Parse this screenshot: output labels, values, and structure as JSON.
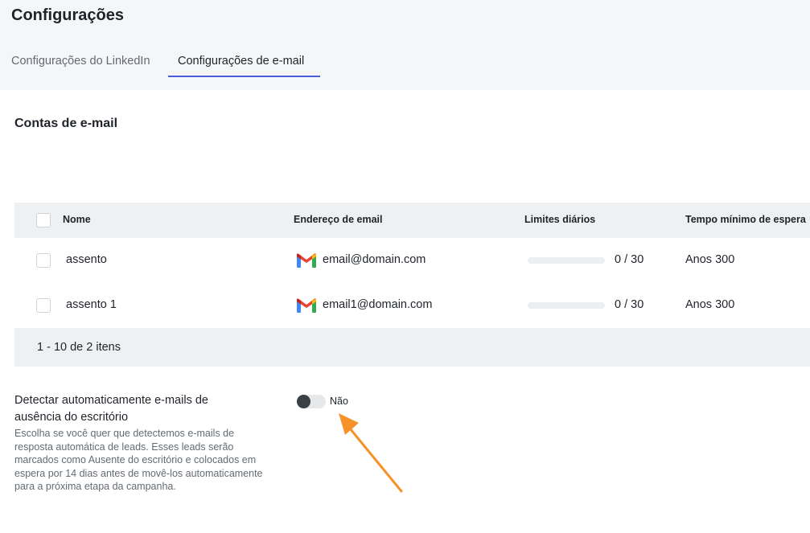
{
  "header": {
    "title": "Configurações",
    "tabs": [
      {
        "label": "Configurações do LinkedIn",
        "active": false
      },
      {
        "label": "Configurações de e-mail",
        "active": true
      }
    ]
  },
  "accounts_section": {
    "title": "Contas de e-mail",
    "columns": {
      "name": "Nome",
      "email": "Endereço de email",
      "limits": "Limites diários",
      "wait": "Tempo mínimo de espera"
    },
    "rows": [
      {
        "name": "assento",
        "email": "email@domain.com",
        "provider_icon": "gmail-icon",
        "limit_used": 0,
        "limit_total": 30,
        "limit_text": "0 / 30",
        "wait": "Anos 300"
      },
      {
        "name": "assento 1",
        "email": "email1@domain.com",
        "provider_icon": "gmail-icon",
        "limit_used": 0,
        "limit_total": 30,
        "limit_text": "0 / 30",
        "wait": "Anos 300"
      }
    ],
    "pagination": "1 - 10 de 2 itens"
  },
  "out_of_office": {
    "title": "Detectar automaticamente e-mails de ausência do escritório",
    "description": "Escolha se você quer que detectemos e-mails de resposta automática de leads. Esses leads serão marcados como Ausente do escritório e colocados em espera por 14 dias antes de movê-los automaticamente para a próxima etapa da campanha.",
    "toggle_on": false,
    "toggle_label": "Não"
  },
  "colors": {
    "accent": "#4a5cd6",
    "annotation_arrow": "#f5922a",
    "header_bg": "#f5f6f7"
  }
}
